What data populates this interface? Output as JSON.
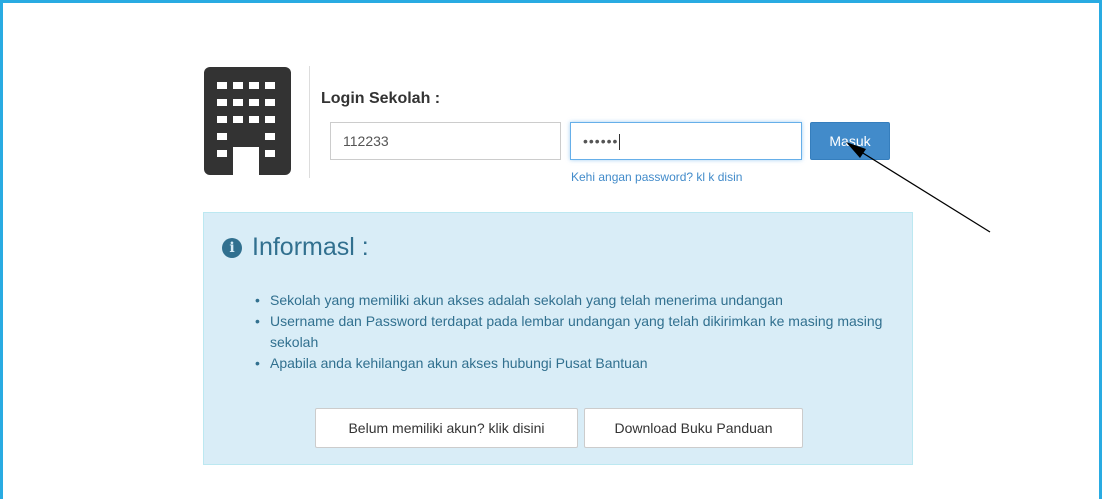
{
  "login": {
    "title": "Login Sekolah :",
    "username_value": "112233",
    "password_value": "••••••",
    "submit_label": "Masuk",
    "forgot_link": "Kehi angan password? kl k disin"
  },
  "info": {
    "title": "Informasl :",
    "items": [
      "Sekolah yang memiliki akun akses adalah sekolah yang telah menerima undangan",
      "Username dan Password terdapat pada lembar undangan yang telah dikirimkan ke masing masing sekolah",
      "Apabila anda kehilangan akun akses hubungi Pusat Bantuan"
    ],
    "register_button": "Belum memiliki akun? klik disini",
    "download_button": "Download Buku Panduan"
  },
  "icons": {
    "building": "building-icon",
    "info": "info-circle-icon",
    "annotation": "arrow-annotation"
  },
  "colors": {
    "frame": "#29abe2",
    "primary": "#428bca",
    "info_bg": "#d9edf7",
    "info_text": "#31708f"
  }
}
